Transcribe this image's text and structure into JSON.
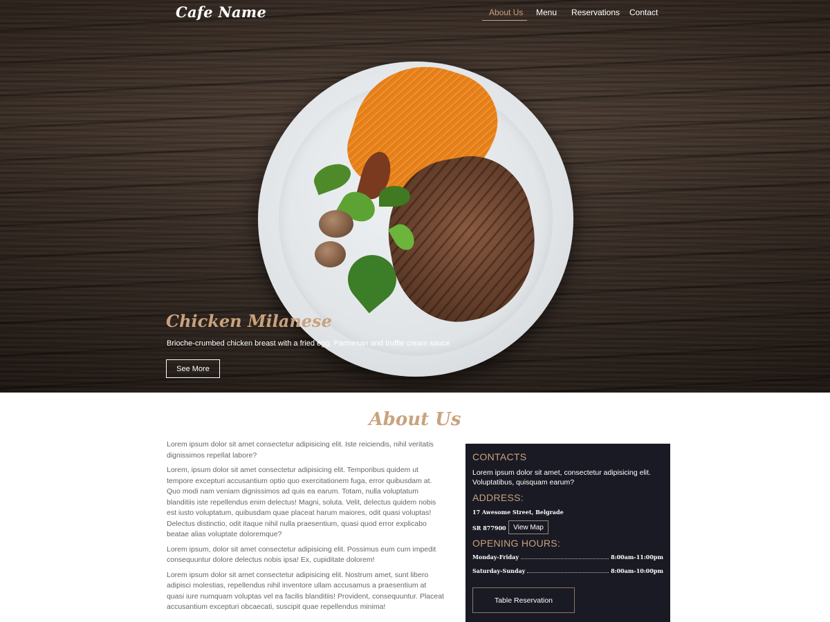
{
  "nav": {
    "logo": "Cafe Name",
    "items": [
      {
        "label": "About Us",
        "active": true
      },
      {
        "label": "Menu",
        "active": false
      },
      {
        "label": "Reservations",
        "active": false
      },
      {
        "label": "Contact",
        "active": false
      }
    ]
  },
  "hero": {
    "title": "Chicken Milanese",
    "description": "Brioche-crumbed chicken breast with a fried egg, Parmesan and truffle cream sauce",
    "button": "See More"
  },
  "about": {
    "title": "About Us",
    "paragraphs": [
      "Lorem ipsum dolor sit amet consectetur adipisicing elit. Iste reiciendis, nihil veritatis dignissimos repellat labore?",
      "Lorem, ipsum dolor sit amet consectetur adipisicing elit. Temporibus quidem ut tempore excepturi accusantium optio quo exercitationem fuga, error quibusdam at. Quo modi nam veniam dignissimos ad quis ea earum. Totam, nulla voluptatum blanditiis iste repellendus enim delectus! Magni, soluta. Velit, delectus quidem nobis est iusto voluptatum, quibusdam quae placeat harum maiores, odit quasi voluptas! Delectus distinctio, odit itaque nihil nulla praesentium, quasi quod error explicabo beatae alias voluptate doloremque?",
      "Lorem ipsum, dolor sit amet consectetur adipisicing elit. Possimus eum cum impedit consequuntur dolore delectus nobis ipsa! Ex, cupiditate dolorem!",
      "Lorem ipsum dolor sit amet consectetur adipisicing elit. Nostrum amet, sunt libero adipisci molestias, repellendus nihil inventore ullam accusamus a praesentium at quasi iure numquam voluptas vel ea facilis blanditiis! Provident, consequuntur. Placeat accusantium excepturi obcaecati, suscipit quae repellendus minima!"
    ]
  },
  "contact": {
    "heading": "CONTACTS",
    "text": "Lorem ipsum dolor sit amet, consectetur adipisicing elit. Voluptatibus, quisquam earum?",
    "address_heading": "ADDRESS:",
    "address": "17 Awesome Street, Belgrade",
    "postal": "SR 877900",
    "map_button": "View Map",
    "hours_heading": "OPENING HOURS:",
    "hours": [
      {
        "days": "Monday-Friday",
        "time": "8:00am-11:00pm"
      },
      {
        "days": "Saturday-Sunday",
        "time": "8:00am-10:00pm"
      }
    ],
    "reservation_button": "Table Reservation"
  },
  "colors": {
    "accent": "#c9a27c",
    "panel_bg": "#1a1a24",
    "body_text": "#666666"
  }
}
